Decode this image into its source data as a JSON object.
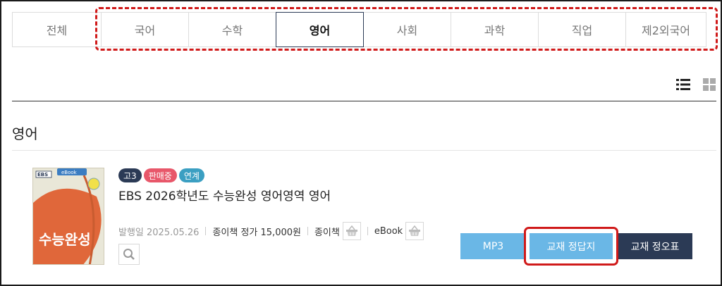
{
  "tabs": [
    {
      "label": "전체",
      "active": false
    },
    {
      "label": "국어",
      "active": false
    },
    {
      "label": "수학",
      "active": false
    },
    {
      "label": "영어",
      "active": true
    },
    {
      "label": "사회",
      "active": false
    },
    {
      "label": "과학",
      "active": false
    },
    {
      "label": "직업",
      "active": false
    },
    {
      "label": "제2외국어",
      "active": false
    }
  ],
  "view_icons": [
    "list-view-icon",
    "grid-view-icon"
  ],
  "section": {
    "title": "영어"
  },
  "book": {
    "badges": {
      "grade": "고3",
      "status": "판매중",
      "linked": "연계"
    },
    "title": "EBS 2026학년도 수능완성 영어영역 영어",
    "publish_date": "발행일 2025.05.26",
    "price": "종이책 정가 15,000원",
    "paper_label": "종이책",
    "ebook_label": "eBook",
    "cover": {
      "brand": "EBS",
      "tag": "eBook",
      "title": "수능완성",
      "accent": "#e0673a"
    }
  },
  "actions": {
    "mp3": "MP3",
    "answer_key": "교재 정답지",
    "errata": "교재 정오표"
  },
  "colors": {
    "navy": "#2b3a55",
    "sky": "#6ab7e6",
    "highlight": "#d01a1a"
  }
}
